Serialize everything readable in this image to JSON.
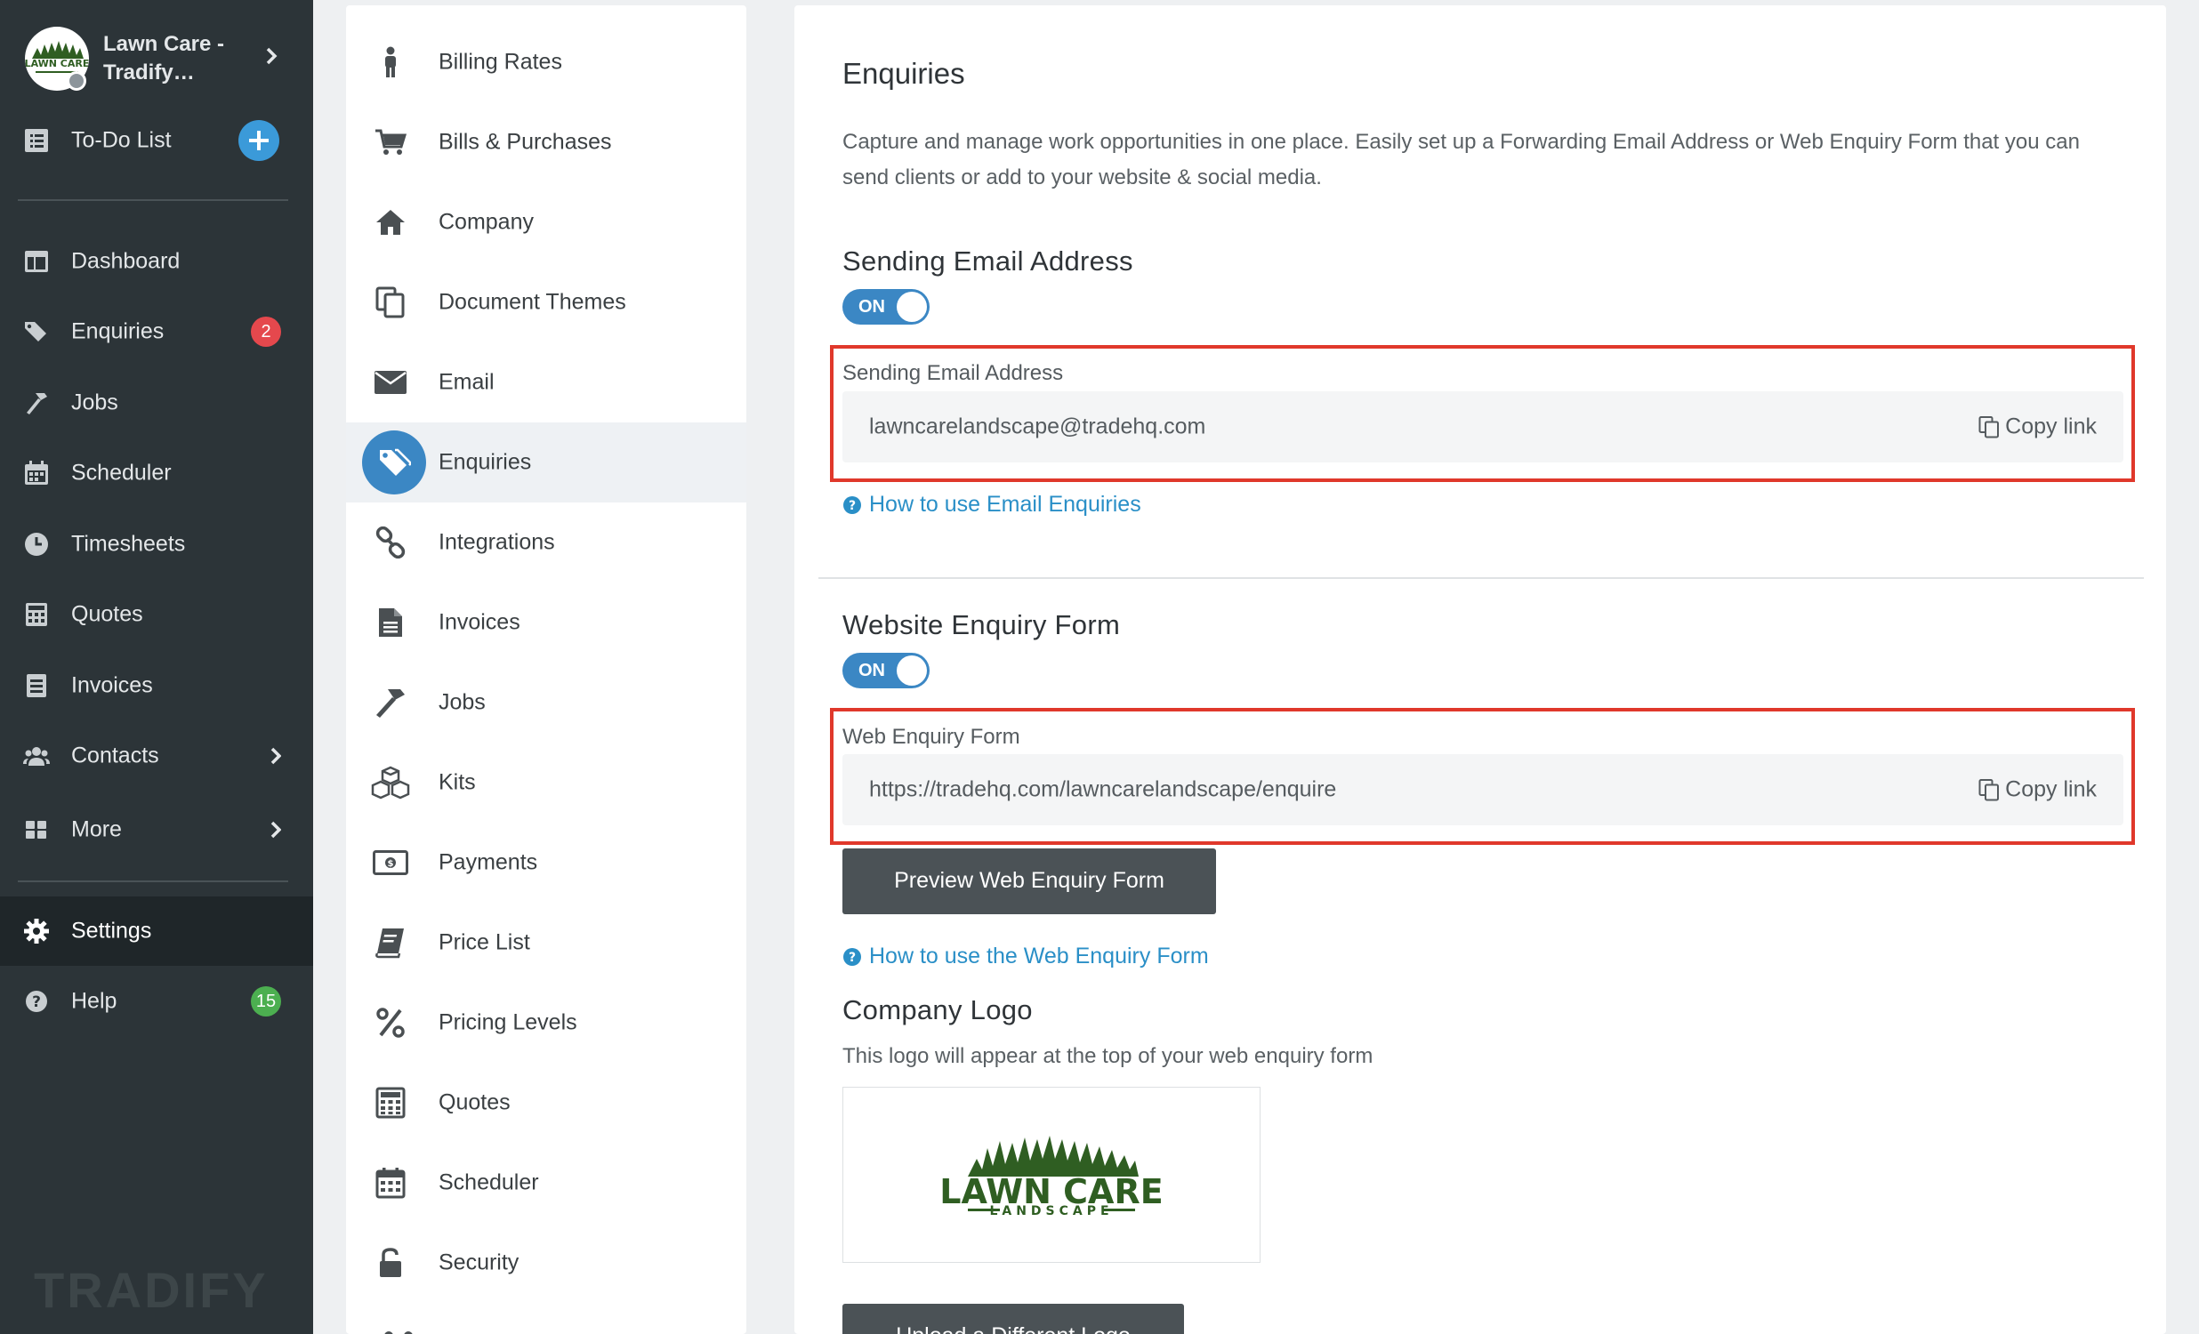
{
  "account": {
    "name": "Lawn Care - Tradify…",
    "logo_text": "LAWN CARE"
  },
  "nav": {
    "todo": {
      "label": "To-Do List"
    },
    "items": [
      {
        "label": "Dashboard"
      },
      {
        "label": "Enquiries",
        "badge": "2"
      },
      {
        "label": "Jobs"
      },
      {
        "label": "Scheduler"
      },
      {
        "label": "Timesheets"
      },
      {
        "label": "Quotes"
      },
      {
        "label": "Invoices"
      },
      {
        "label": "Contacts"
      },
      {
        "label": "More"
      }
    ],
    "settings": {
      "label": "Settings"
    },
    "help": {
      "label": "Help",
      "badge": "15"
    },
    "brand": "TRADIFY",
    "colors": {
      "bg": "#2c3438",
      "badge_red": "#e5484d",
      "badge_green": "#4caf50",
      "accent": "#3b9ad9"
    }
  },
  "settings_menu": {
    "items": [
      {
        "label": "Billing Rates",
        "icon": "person-icon"
      },
      {
        "label": "Bills & Purchases",
        "icon": "cart-icon"
      },
      {
        "label": "Company",
        "icon": "home-icon"
      },
      {
        "label": "Document Themes",
        "icon": "copy-icon"
      },
      {
        "label": "Email",
        "icon": "envelope-icon"
      },
      {
        "label": "Enquiries",
        "icon": "tags-icon"
      },
      {
        "label": "Integrations",
        "icon": "link-icon"
      },
      {
        "label": "Invoices",
        "icon": "file-icon"
      },
      {
        "label": "Jobs",
        "icon": "hammer-icon"
      },
      {
        "label": "Kits",
        "icon": "cubes-icon"
      },
      {
        "label": "Payments",
        "icon": "money-icon"
      },
      {
        "label": "Price List",
        "icon": "book-icon"
      },
      {
        "label": "Pricing Levels",
        "icon": "percent-icon"
      },
      {
        "label": "Quotes",
        "icon": "calculator-icon"
      },
      {
        "label": "Scheduler",
        "icon": "calendar-icon"
      },
      {
        "label": "Security",
        "icon": "unlock-icon"
      }
    ],
    "active": "Enquiries",
    "accent": "#3b87c4"
  },
  "main": {
    "title": "Enquiries",
    "description": "Capture and manage work opportunities in one place. Easily set up a Forwarding Email Address or Web Enquiry Form that you can send clients or add to your website & social media.",
    "sending_email": {
      "heading": "Sending Email Address",
      "toggle": "ON",
      "field_label": "Sending Email Address",
      "value": "lawncarelandscape@tradehq.com",
      "copy_label": "Copy link",
      "help_link": "How to use Email Enquiries"
    },
    "web_form": {
      "heading": "Website Enquiry Form",
      "toggle": "ON",
      "field_label": "Web Enquiry Form",
      "value": "https://tradehq.com/lawncarelandscape/enquire",
      "copy_label": "Copy link",
      "preview_button": "Preview Web Enquiry Form",
      "help_link": "How to use the Web Enquiry Form"
    },
    "company_logo": {
      "heading": "Company Logo",
      "description": "This logo will appear at the top of your web enquiry form",
      "logo_title": "LAWN CARE",
      "logo_subtitle": "LANDSCAPE",
      "upload_button": "Upload a Different Logo"
    },
    "colors": {
      "highlight": "#e0382b",
      "link": "#2a8fc7",
      "toggle": "#3b87c4",
      "logo_green": "#2f5e22"
    }
  }
}
